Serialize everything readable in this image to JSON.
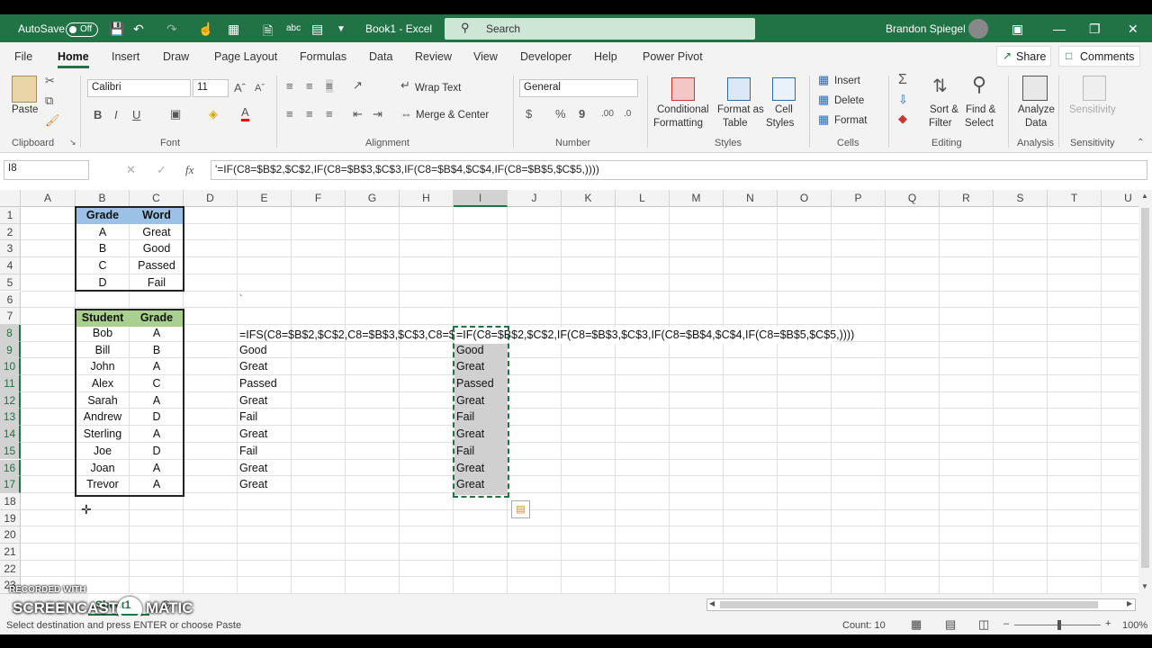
{
  "titlebar": {
    "autosave_label": "AutoSave",
    "autosave_state": "Off",
    "doc_title": "Book1 - Excel",
    "search_placeholder": "Search",
    "user_name": "Brandon Spiegel"
  },
  "menu": {
    "tabs": [
      "File",
      "Home",
      "Insert",
      "Draw",
      "Page Layout",
      "Formulas",
      "Data",
      "Review",
      "View",
      "Developer",
      "Help",
      "Power Pivot"
    ],
    "share": "Share",
    "comments": "Comments"
  },
  "ribbon": {
    "clipboard": {
      "paste": "Paste",
      "group": "Clipboard"
    },
    "font": {
      "name": "Calibri",
      "size": "11",
      "group": "Font"
    },
    "alignment": {
      "wrap": "Wrap Text",
      "merge": "Merge & Center",
      "group": "Alignment"
    },
    "number": {
      "format": "General",
      "group": "Number"
    },
    "styles": {
      "cond1": "Conditional",
      "cond2": "Formatting",
      "fmt1": "Format as",
      "fmt2": "Table",
      "cell1": "Cell",
      "cell2": "Styles",
      "group": "Styles"
    },
    "cells": {
      "insert": "Insert",
      "delete": "Delete",
      "format": "Format",
      "group": "Cells"
    },
    "editing": {
      "sort1": "Sort &",
      "sort2": "Filter",
      "find1": "Find &",
      "find2": "Select",
      "group": "Editing"
    },
    "analysis": {
      "a1": "Analyze",
      "a2": "Data",
      "group": "Analysis"
    },
    "sensitivity": {
      "label": "Sensitivity",
      "group": "Sensitivity"
    }
  },
  "formula_bar": {
    "name_box": "I8",
    "fx": "fx",
    "formula": "'=IF(C8=$B$2,$C$2,IF(C8=$B$3,$C$3,IF(C8=$B$4,$C$4,IF(C8=$B$5,$C$5,))))"
  },
  "columns": [
    "A",
    "B",
    "C",
    "D",
    "E",
    "F",
    "G",
    "H",
    "I",
    "J",
    "K",
    "L",
    "M",
    "N",
    "O",
    "P",
    "Q",
    "R",
    "S",
    "T",
    "U"
  ],
  "rows": [
    "1",
    "2",
    "3",
    "4",
    "5",
    "6",
    "7",
    "8",
    "9",
    "10",
    "11",
    "12",
    "13",
    "14",
    "15",
    "16",
    "17",
    "18",
    "19",
    "20",
    "21",
    "22",
    "23"
  ],
  "table1": {
    "headers": [
      "Grade",
      "Word"
    ],
    "rows": [
      [
        "A",
        "Great"
      ],
      [
        "B",
        "Good"
      ],
      [
        "C",
        "Passed"
      ],
      [
        "D",
        "Fail"
      ]
    ]
  },
  "table2": {
    "headers": [
      "Student",
      "Grade"
    ],
    "rows": [
      [
        "Bob",
        "A"
      ],
      [
        "Bill",
        "B"
      ],
      [
        "John",
        "A"
      ],
      [
        "Alex",
        "C"
      ],
      [
        "Sarah",
        "A"
      ],
      [
        "Andrew",
        "D"
      ],
      [
        "Sterling",
        "A"
      ],
      [
        "Joe",
        "D"
      ],
      [
        "Joan",
        "A"
      ],
      [
        "Trevor",
        "A"
      ]
    ]
  },
  "col_e": {
    "e8": "=IFS(C8=$B$2,$C$2,C8=$B$3,$C$3,C8=$B$",
    "values": [
      "Good",
      "Great",
      "Passed",
      "Great",
      "Fail",
      "Great",
      "Fail",
      "Great",
      "Great"
    ]
  },
  "col_i": {
    "i8": "=IF(C8=$B$2,$C$2,IF(C8=$B$3,$C$3,IF(C8=$B$4,$C$4,IF(C8=$B$5,$C$5,))))",
    "values": [
      "Good",
      "Great",
      "Passed",
      "Great",
      "Fail",
      "Great",
      "Fail",
      "Great",
      "Great"
    ]
  },
  "tick_mark": "`",
  "sheet": {
    "tab": "Sheet1",
    "watermark_top": "RECORDED WITH",
    "watermark_main": "SCREENCAST",
    "watermark_end": "MATIC"
  },
  "status": {
    "message": "Select destination and press ENTER or choose Paste",
    "count": "Count: 10",
    "zoom": "100%"
  },
  "colors": {
    "excel_green": "#217346",
    "header_blue": "#9bc2e6",
    "header_green": "#a9d08e",
    "selection_gray": "#d0d0d0"
  }
}
